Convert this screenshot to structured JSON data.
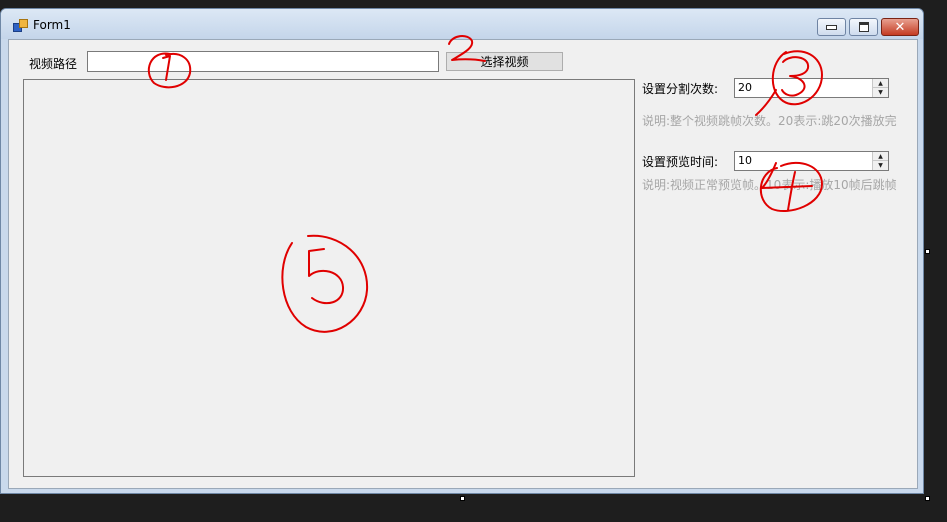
{
  "window": {
    "title": "Form1"
  },
  "path_row": {
    "label": "视频路径",
    "value": "",
    "button_label": "选择视频"
  },
  "split": {
    "label": "设置分割次数:",
    "value": "20",
    "hint": "说明:整个视频跳帧次数。20表示:跳20次播放完"
  },
  "preview": {
    "label": "设置预览时间:",
    "value": "10",
    "hint": "说明:视频正常预览帧。10表示:播放10帧后跳帧"
  },
  "icons": {
    "app": "app-icon",
    "minimize": "minimize-icon",
    "maximize": "maximize-icon",
    "close": "close-icon",
    "spin_up": "spin-up-icon",
    "spin_down": "spin-down-icon"
  },
  "annotations": [
    "1",
    "2",
    "3",
    "4",
    "5"
  ],
  "colors": {
    "annotation": "#e00000",
    "title_bar": "#c9d9ec",
    "client": "#f0f0f0",
    "hint_text": "#a6a6a6",
    "desktop": "#1e1e1e"
  }
}
